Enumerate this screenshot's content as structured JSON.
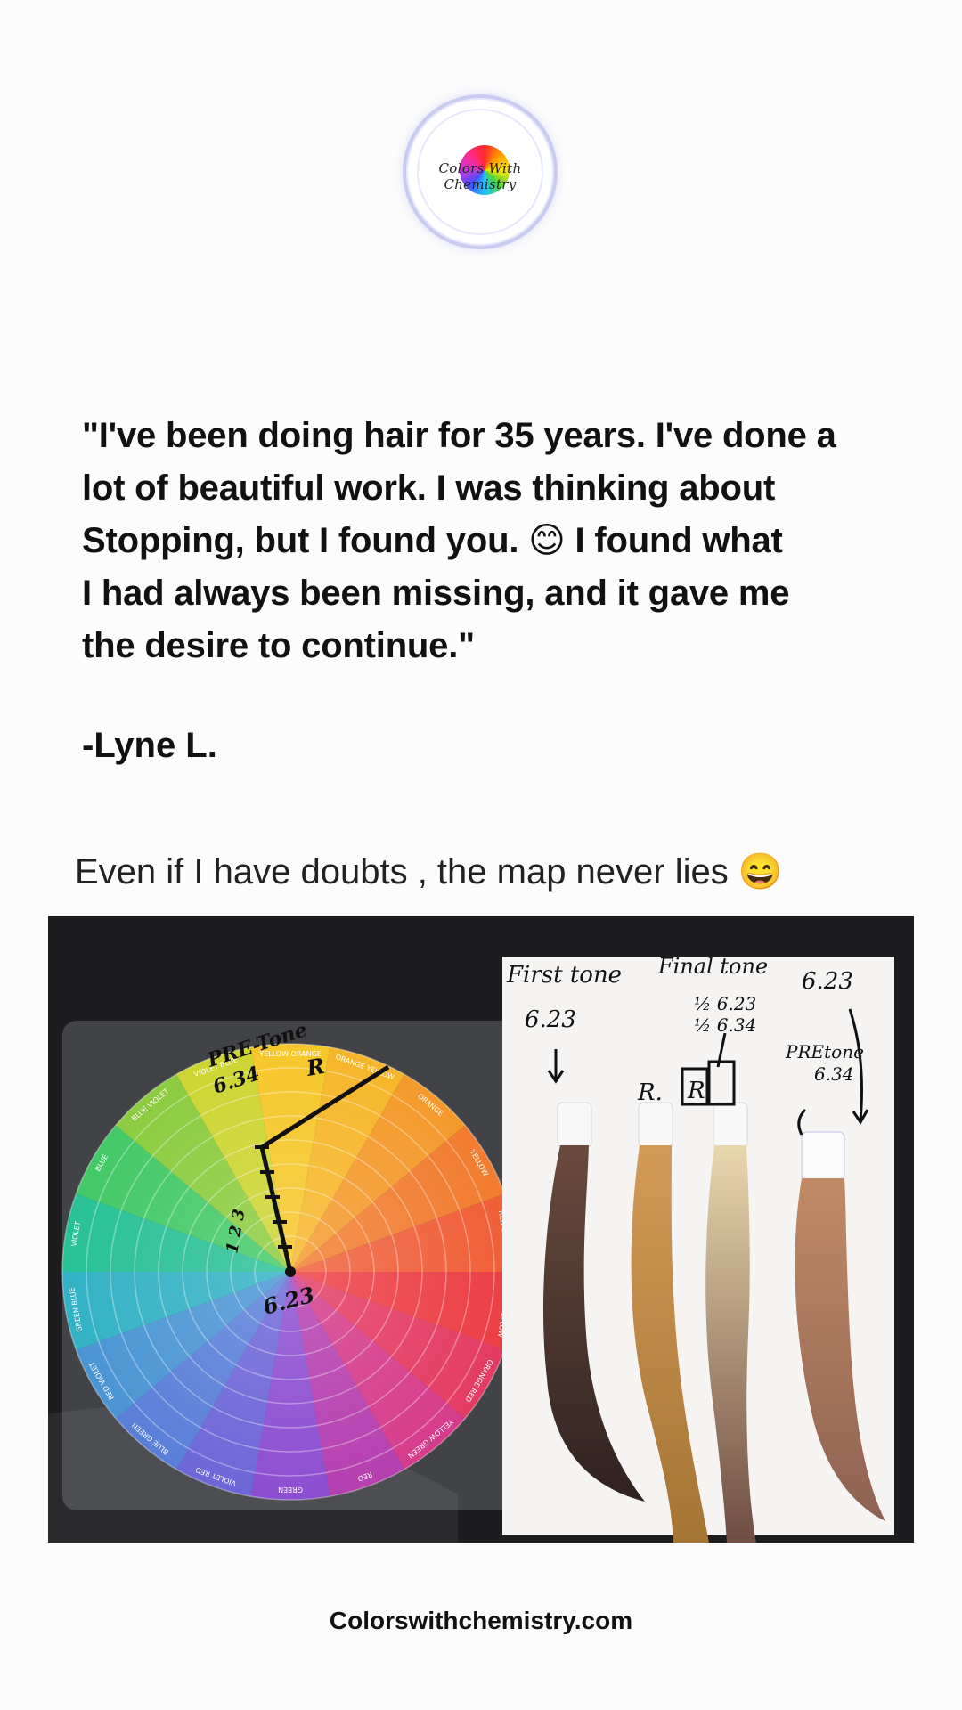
{
  "logo": {
    "text": "Colors With Chemistry"
  },
  "quote": {
    "lines": [
      "\"I've been doing hair for 35 years. I've done a",
      "lot of beautiful work. I was thinking about",
      "Stopping, but I found you. 😊 I found what",
      "I had always been missing, and it gave me",
      "the desire to continue.\""
    ],
    "author": "-Lyne L."
  },
  "caption": "Even if I have doubts , the map never lies 😄",
  "photo": {
    "wheel_labels": [
      "YELLOW ORANGE",
      "ORANGE YELLOW",
      "ORANGE",
      "YELLOW",
      "RED ORANGE",
      "GREEN YELLOW",
      "ORANGE RED",
      "YELLOW GREEN",
      "RED",
      "GREEN",
      "VIOLET RED",
      "BLUE GREEN",
      "RED VIOLET",
      "GREEN BLUE",
      "VIOLET",
      "BLUE",
      "BLUE VIOLET",
      "VIOLET BLUE"
    ],
    "wheel_notes": {
      "pretone": "PRE-Tone",
      "pretone_value": "6.34",
      "r": "R",
      "center": "6.23",
      "marks": "1 2 3"
    },
    "board_notes": {
      "first_tone": "First tone",
      "first_value": "6.23",
      "final_tone": "Final tone",
      "final_mix_1": "½ 6.23",
      "final_mix_2": "½ 6.34",
      "r_dot": "R.",
      "r_box": "R",
      "right_top": "6.23",
      "pretone": "PREtone",
      "pretone_value": "6.34"
    }
  },
  "footer": {
    "website": "Colorswithchemistry.com"
  }
}
